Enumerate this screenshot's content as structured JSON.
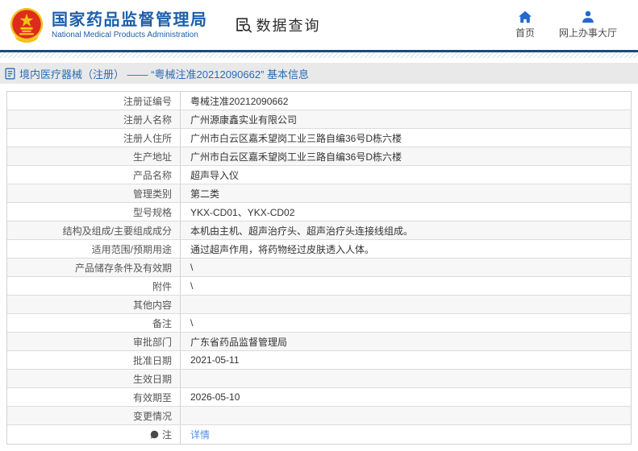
{
  "header": {
    "org_name_cn": "国家药品监督管理局",
    "org_name_en": "National Medical Products Administration",
    "data_query_label": "数据查询",
    "nav_home_label": "首页",
    "nav_service_hall_label": "网上办事大厅"
  },
  "breadcrumb": {
    "title": "境内医疗器械（注册） —— “粤械注准20212090662” 基本信息"
  },
  "table": {
    "rows": [
      {
        "label": "注册证编号",
        "value": "粤械注准20212090662"
      },
      {
        "label": "注册人名称",
        "value": "广州源康鑫实业有限公司"
      },
      {
        "label": "注册人住所",
        "value": "广州市白云区嘉禾望岗工业三路自编36号D栋六楼"
      },
      {
        "label": "生产地址",
        "value": "广州市白云区嘉禾望岗工业三路自编36号D栋六楼"
      },
      {
        "label": "产品名称",
        "value": "超声导入仪"
      },
      {
        "label": "管理类别",
        "value": "第二类"
      },
      {
        "label": "型号规格",
        "value": "YKX-CD01、YKX-CD02"
      },
      {
        "label": "结构及组成/主要组成成分",
        "value": "本机由主机、超声治疗头、超声治疗头连接线组成。"
      },
      {
        "label": "适用范围/预期用途",
        "value": "通过超声作用，将药物经过皮肤透入人体。"
      },
      {
        "label": "产品储存条件及有效期",
        "value": "\\"
      },
      {
        "label": "附件",
        "value": "\\"
      },
      {
        "label": "其他内容",
        "value": ""
      },
      {
        "label": "备注",
        "value": "\\"
      },
      {
        "label": "审批部门",
        "value": "广东省药品监督管理局"
      },
      {
        "label": "批准日期",
        "value": "2021-05-11"
      },
      {
        "label": "生效日期",
        "value": ""
      },
      {
        "label": "有效期至",
        "value": "2026-05-10"
      },
      {
        "label": "变更情况",
        "value": ""
      },
      {
        "label": "注",
        "value": "详情",
        "link": true,
        "has_icon": true
      }
    ]
  },
  "icons": {
    "national-emblem-icon": "china national emblem (red disc, gold star, gold ring)",
    "doc-search-icon": "document with magnifier",
    "home-icon": "house",
    "person-icon": "person bust",
    "document-icon": "blue page with lines",
    "note-icon": "dark speech bubble"
  },
  "colors": {
    "brand_blue": "#1e5fa9",
    "navy_line": "#174b80",
    "breadcrumb_blue": "#2a6cb5",
    "link_blue": "#4a90e2",
    "bar_bg": "#e9e9e9",
    "row_alt_bg": "#f7f7f7",
    "border": "#d2d2d2",
    "nav_icon_blue": "#2468d0"
  }
}
